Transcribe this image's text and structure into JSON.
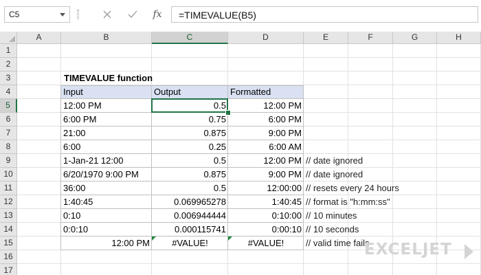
{
  "formula_bar": {
    "name_box": "C5",
    "formula": "=TIMEVALUE(B5)",
    "cancel_icon": "x-icon",
    "enter_icon": "check-icon",
    "fx_label": "fx"
  },
  "columns": [
    "A",
    "B",
    "C",
    "D",
    "E",
    "F",
    "G",
    "H"
  ],
  "rows": [
    "1",
    "2",
    "3",
    "4",
    "5",
    "6",
    "7",
    "8",
    "9",
    "10",
    "11",
    "12",
    "13",
    "14",
    "15",
    "16",
    "17"
  ],
  "selected": {
    "column": "C",
    "row": "5"
  },
  "title": "TIMEVALUE function",
  "table": {
    "headers": [
      "Input",
      "Output",
      "Formatted"
    ],
    "rows": [
      {
        "input": "12:00 PM",
        "output": "0.5",
        "formatted": "12:00 PM",
        "note": ""
      },
      {
        "input": "6:00 PM",
        "output": "0.75",
        "formatted": "6:00 PM",
        "note": ""
      },
      {
        "input": "21:00",
        "output": "0.875",
        "formatted": "9:00 PM",
        "note": ""
      },
      {
        "input": "6:00",
        "output": "0.25",
        "formatted": "6:00 AM",
        "note": ""
      },
      {
        "input": "1-Jan-21 12:00",
        "output": "0.5",
        "formatted": "12:00 PM",
        "note": "// date ignored"
      },
      {
        "input": "6/20/1970 9:00 PM",
        "output": "0.875",
        "formatted": "9:00 PM",
        "note": "// date ignored"
      },
      {
        "input": "36:00",
        "output": "0.5",
        "formatted": "12:00:00",
        "note": "// resets every 24 hours"
      },
      {
        "input": "1:40:45",
        "output": "0.069965278",
        "formatted": "1:40:45",
        "note": "// format is \"h:mm:ss\""
      },
      {
        "input": "0:10",
        "output": "0.006944444",
        "formatted": "0:10:00",
        "note": "// 10 minutes"
      },
      {
        "input": "0:0:10",
        "output": "0.000115741",
        "formatted": "0:00:10",
        "note": "// 10 seconds"
      },
      {
        "input": "12:00 PM",
        "output": "#VALUE!",
        "formatted": "#VALUE!",
        "note": "// valid time fails"
      }
    ]
  },
  "logo": {
    "text": "EXCELJET"
  },
  "colors": {
    "header_fill": "#d9e1f2",
    "selection": "#217346",
    "logo": "#d4d4d4"
  }
}
